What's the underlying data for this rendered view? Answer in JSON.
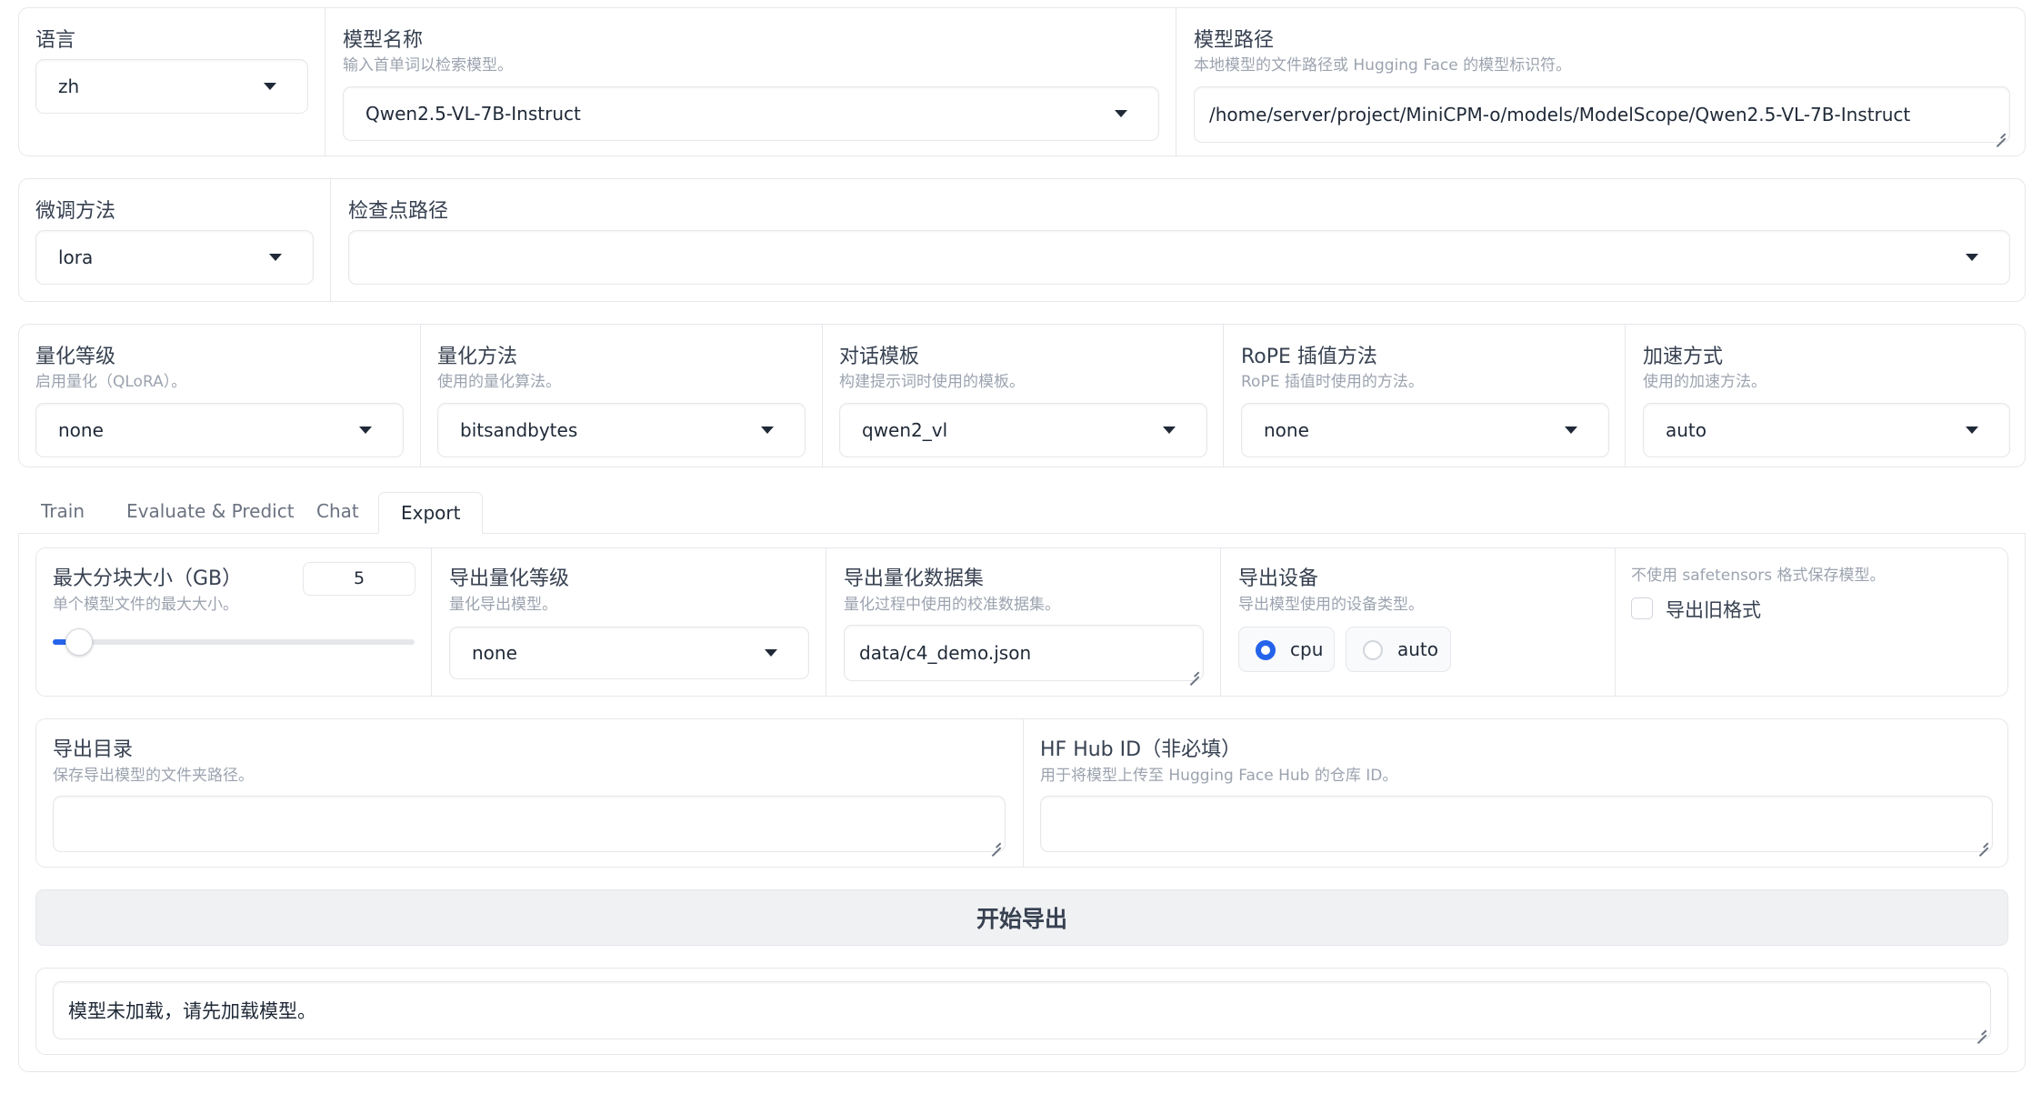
{
  "top": {
    "language": {
      "label": "语言",
      "value": "zh"
    },
    "model_name": {
      "label": "模型名称",
      "info": "输入首单词以检索模型。",
      "value": "Qwen2.5-VL-7B-Instruct"
    },
    "model_path": {
      "label": "模型路径",
      "info": "本地模型的文件路径或 Hugging Face 的模型标识符。",
      "value": "/home/server/project/MiniCPM-o/models/ModelScope/Qwen2.5-VL-7B-Instruct"
    }
  },
  "finetune": {
    "method": {
      "label": "微调方法",
      "value": "lora"
    },
    "checkpoint": {
      "label": "检查点路径",
      "value": ""
    }
  },
  "advanced": [
    {
      "label": "量化等级",
      "info": "启用量化（QLoRA）。",
      "value": "none"
    },
    {
      "label": "量化方法",
      "info": "使用的量化算法。",
      "value": "bitsandbytes"
    },
    {
      "label": "对话模板",
      "info": "构建提示词时使用的模板。",
      "value": "qwen2_vl"
    },
    {
      "label": "RoPE 插值方法",
      "info": "RoPE 插值时使用的方法。",
      "value": "none"
    },
    {
      "label": "加速方式",
      "info": "使用的加速方法。",
      "value": "auto"
    }
  ],
  "tabs": [
    "Train",
    "Evaluate & Predict",
    "Chat",
    "Export"
  ],
  "active_tab": "Export",
  "export": {
    "max_shard": {
      "label": "最大分块大小（GB）",
      "info": "单个模型文件的最大大小。",
      "value": "5",
      "slider_fraction": 0.04
    },
    "export_quant": {
      "label": "导出量化等级",
      "info": "量化导出模型。",
      "value": "none"
    },
    "quant_dataset": {
      "label": "导出量化数据集",
      "info": "量化过程中使用的校准数据集。",
      "value": "data/c4_demo.json"
    },
    "device": {
      "label": "导出设备",
      "info": "导出模型使用的设备类型。",
      "options": [
        "cpu",
        "auto"
      ],
      "selected": "cpu"
    },
    "legacy": {
      "info": "不使用 safetensors 格式保存模型。",
      "label": "导出旧格式",
      "checked": false
    },
    "export_dir": {
      "label": "导出目录",
      "info": "保存导出模型的文件夹路径。",
      "value": ""
    },
    "hub_id": {
      "label": "HF Hub ID（非必填）",
      "info": "用于将模型上传至 Hugging Face Hub 的仓库 ID。",
      "value": ""
    },
    "start_button": "开始导出",
    "output": "模型未加载，请先加载模型。"
  },
  "colors": {
    "accent": "#2563eb",
    "border": "#e5e7eb",
    "info": "#9ca3af"
  }
}
